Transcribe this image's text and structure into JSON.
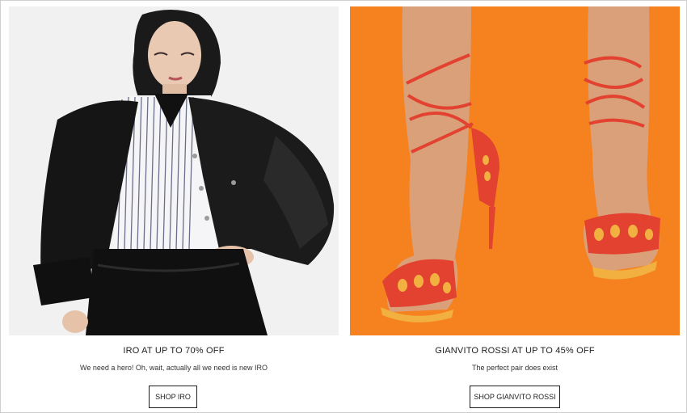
{
  "promos": [
    {
      "title": "IRO AT UP TO 70% OFF",
      "subtitle": "We need a hero! Oh, wait, actually all we need is new IRO",
      "button": "SHOP IRO",
      "image_alt": "Model wearing black leather jacket and striped shirt",
      "image_bg": "#f1f1f1"
    },
    {
      "title": "GIANVITO ROSSI AT UP TO 45% OFF",
      "subtitle": "The perfect pair does exist",
      "button": "SHOP GIANVITO ROSSI",
      "image_alt": "Red lace-up sandals on orange background",
      "image_bg": "#f6821f"
    }
  ],
  "colors": {
    "accent_orange": "#f6821f",
    "sandal_red": "#e2422f",
    "text": "#222222"
  }
}
